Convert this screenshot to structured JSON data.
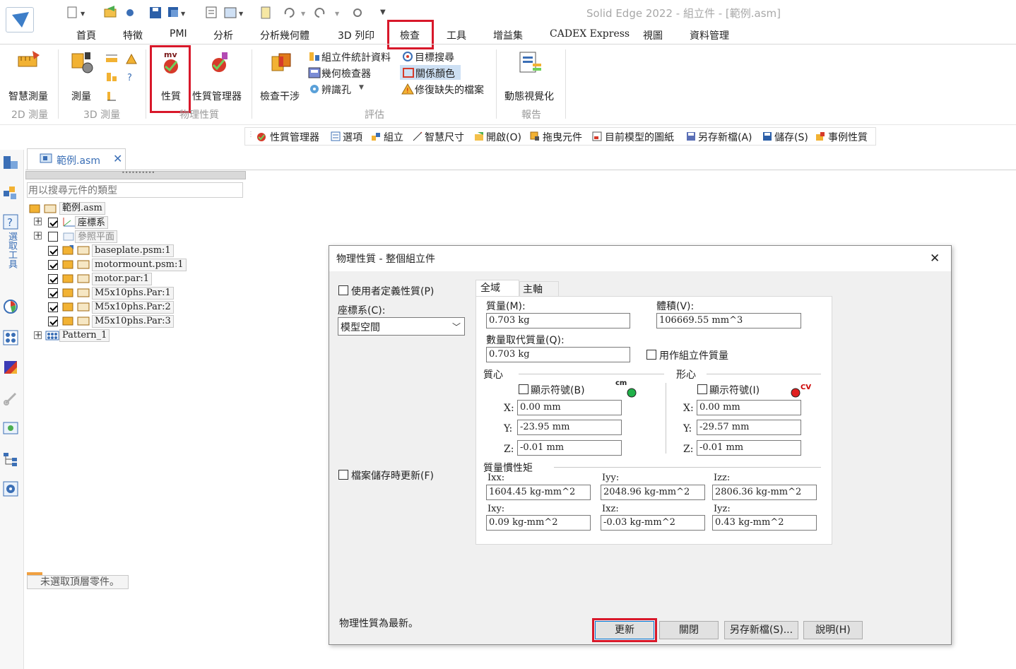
{
  "title_bar": {
    "title": "Solid Edge 2022 - 組立件 - [範例.asm]"
  },
  "menu_tabs": [
    "首頁",
    "特徵",
    "PMI",
    "分析",
    "分析幾何體",
    "3D 列印",
    "檢查",
    "工具",
    "增益集",
    "CADEX Express",
    "視圖",
    "資料管理"
  ],
  "ribbon": {
    "smart_measure": "智慧測量",
    "measure": "測量",
    "properties": "性質",
    "properties_manager": "性質管理器",
    "interference": "檢查干涉",
    "asm_stats": "組立件統計資料",
    "geom_inspector": "幾何檢查器",
    "identify_holes": "辨識孔",
    "target_search": "目標搜尋",
    "relation_colors": "關係顏色",
    "repair_missing": "修復缺失的檔案",
    "dynamic_viz": "動態視覺化",
    "group_2d": "2D 測量",
    "group_3d": "3D 測量",
    "group_phys": "物理性質",
    "group_eval": "評估",
    "group_report": "報告",
    "mv_text": "mv"
  },
  "toolbar2": [
    "性質管理器",
    "選項",
    "組立",
    "智慧尺寸",
    "開啟(O)",
    "拖曳元件",
    "目前模型的圖紙",
    "另存新檔(A)",
    "儲存(S)",
    "事例性質"
  ],
  "doc_tab": {
    "name": "範例.asm"
  },
  "side_label": "選取工具",
  "search": {
    "placeholder": "用以搜尋元件的類型"
  },
  "tree": {
    "root": "範例.asm",
    "items": [
      {
        "label": "座標系",
        "checked": true
      },
      {
        "label": "參照平面",
        "checked": false
      },
      {
        "label": "baseplate.psm:1",
        "checked": true
      },
      {
        "label": "motormount.psm:1",
        "checked": true
      },
      {
        "label": "motor.par:1",
        "checked": true
      },
      {
        "label": "M5x10phs.Par:1",
        "checked": true
      },
      {
        "label": "M5x10phs.Par:2",
        "checked": true
      },
      {
        "label": "M5x10phs.Par:3",
        "checked": true
      },
      {
        "label": "Pattern_1",
        "checked": false
      }
    ]
  },
  "status_bottom": "未選取頂層零件。",
  "dialog": {
    "title": "物理性質 - 整個組立件",
    "close": "✕",
    "user_defined": "使用者定義性質(P)",
    "coord_label": "座標系(C):",
    "coord_value": "模型空間",
    "update_on_save": "檔案儲存時更新(F)",
    "status": "物理性質為最新。",
    "tabs": [
      "全域",
      "主軸"
    ],
    "mass_label": "質量(M):",
    "mass": "0.703 kg",
    "volume_label": "體積(V):",
    "volume": "106669.55 mm^3",
    "mass_override_label": "數量取代質量(Q):",
    "mass_override": "0.703 kg",
    "use_as_asm_mass": "用作組立件質量",
    "center_mass_title": "質心",
    "centroid_title": "形心",
    "show_symbol_b": "顯示符號(B)",
    "show_symbol_i": "顯示符號(I)",
    "cm_tag": "cm",
    "cv_tag": "cv",
    "axis_x": "X:",
    "axis_y": "Y:",
    "axis_z": "Z:",
    "cm": {
      "x": "0.00 mm",
      "y": "-23.95 mm",
      "z": "-0.01 mm"
    },
    "cv": {
      "x": "0.00 mm",
      "y": "-29.57 mm",
      "z": "-0.01 mm"
    },
    "inertia_title": "質量慣性矩",
    "inertia": [
      {
        "label": "Ixx:",
        "value": "1604.45 kg-mm^2"
      },
      {
        "label": "Iyy:",
        "value": "2048.96 kg-mm^2"
      },
      {
        "label": "Izz:",
        "value": "2806.36 kg-mm^2"
      },
      {
        "label": "Ixy:",
        "value": "0.09 kg-mm^2"
      },
      {
        "label": "Ixz:",
        "value": "-0.03 kg-mm^2"
      },
      {
        "label": "Iyz:",
        "value": "0.43 kg-mm^2"
      }
    ],
    "buttons": {
      "update": "更新",
      "close": "關閉",
      "save_as": "另存新檔(S)...",
      "help": "說明(H)"
    }
  }
}
